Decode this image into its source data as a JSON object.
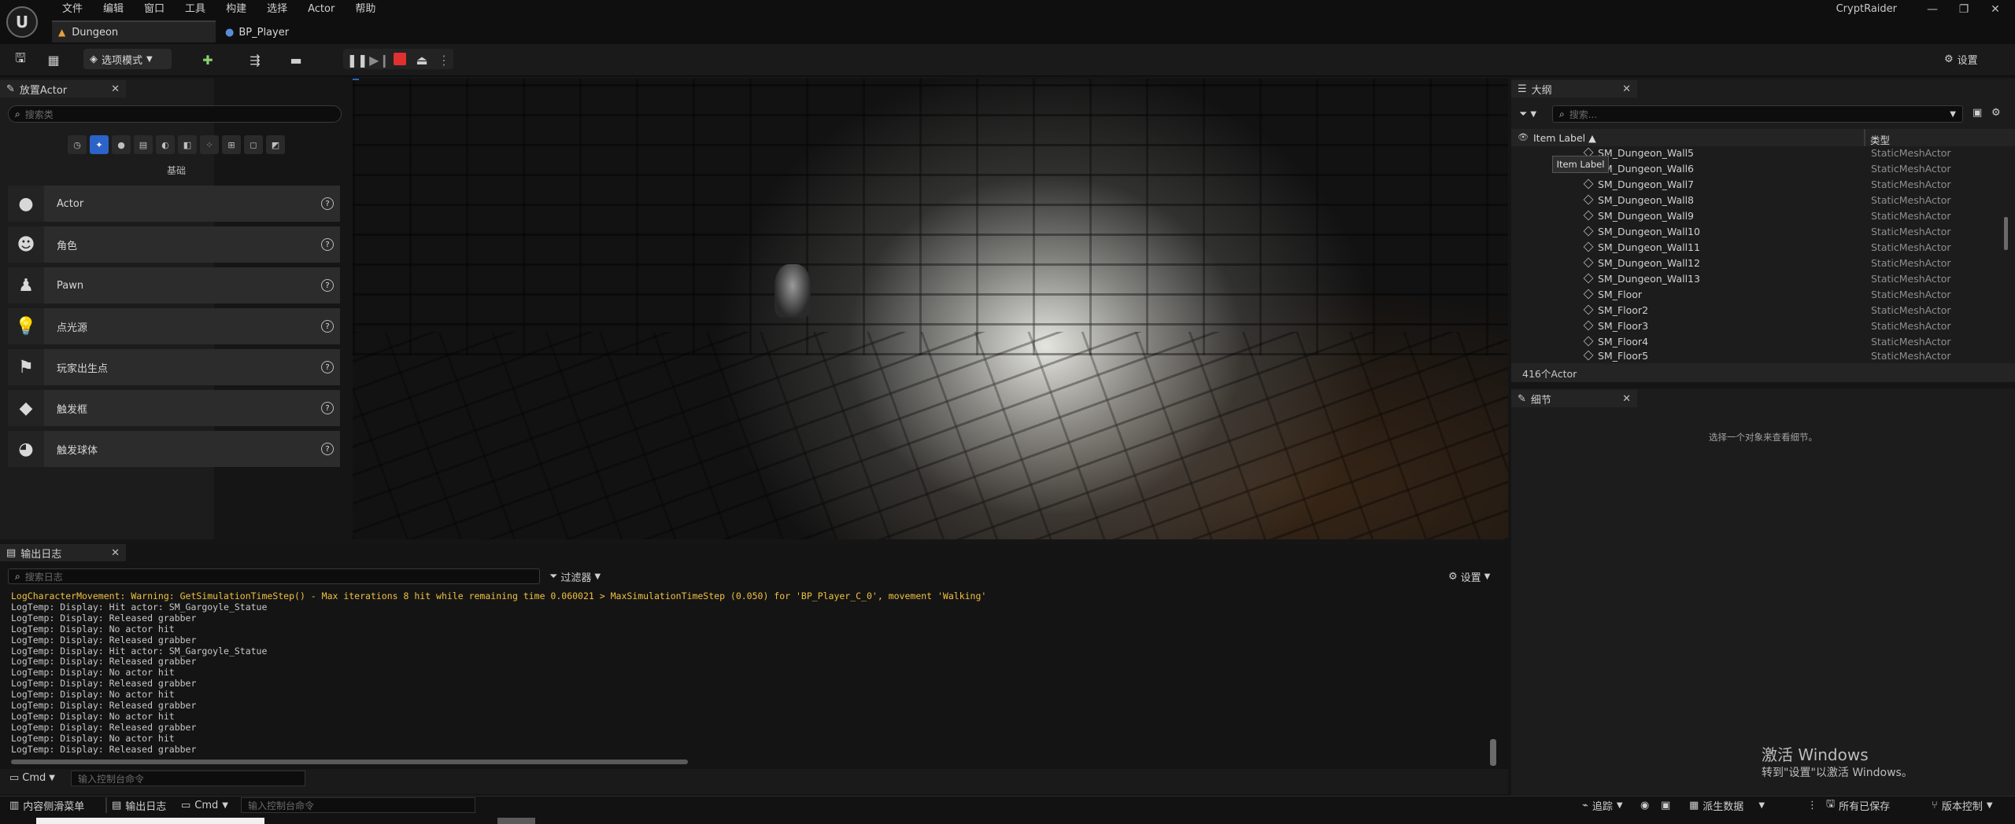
{
  "app": {
    "name": "CryptRaider"
  },
  "menu": [
    "文件",
    "编辑",
    "窗口",
    "工具",
    "构建",
    "选择",
    "Actor",
    "帮助"
  ],
  "tabs": [
    {
      "label": "Dungeon"
    },
    {
      "label": "BP_Player"
    }
  ],
  "toolbar": {
    "mode_label": "选项模式",
    "settings_label": "设置"
  },
  "place_actors": {
    "title": "放置Actor",
    "search_placeholder": "搜索类",
    "category_label": "基础",
    "items": [
      {
        "label": "Actor",
        "icon": "sphere-icon"
      },
      {
        "label": "角色",
        "icon": "character-icon"
      },
      {
        "label": "Pawn",
        "icon": "pawn-icon"
      },
      {
        "label": "点光源",
        "icon": "point-light-icon"
      },
      {
        "label": "玩家出生点",
        "icon": "player-start-icon"
      },
      {
        "label": "触发框",
        "icon": "trigger-box-icon"
      },
      {
        "label": "触发球体",
        "icon": "trigger-sphere-icon"
      }
    ]
  },
  "outliner": {
    "title": "大纲",
    "search_placeholder": "搜索...",
    "col_label": "Item Label",
    "col_type": "类型",
    "tooltip": "Item Label",
    "rows": [
      {
        "name": "SM_Dungeon_Wall5",
        "type": "StaticMeshActor"
      },
      {
        "name": "SM_Dungeon_Wall6",
        "type": "StaticMeshActor"
      },
      {
        "name": "SM_Dungeon_Wall7",
        "type": "StaticMeshActor"
      },
      {
        "name": "SM_Dungeon_Wall8",
        "type": "StaticMeshActor"
      },
      {
        "name": "SM_Dungeon_Wall9",
        "type": "StaticMeshActor"
      },
      {
        "name": "SM_Dungeon_Wall10",
        "type": "StaticMeshActor"
      },
      {
        "name": "SM_Dungeon_Wall11",
        "type": "StaticMeshActor"
      },
      {
        "name": "SM_Dungeon_Wall12",
        "type": "StaticMeshActor"
      },
      {
        "name": "SM_Dungeon_Wall13",
        "type": "StaticMeshActor"
      },
      {
        "name": "SM_Floor",
        "type": "StaticMeshActor"
      },
      {
        "name": "SM_Floor2",
        "type": "StaticMeshActor"
      },
      {
        "name": "SM_Floor3",
        "type": "StaticMeshActor"
      },
      {
        "name": "SM_Floor4",
        "type": "StaticMeshActor"
      },
      {
        "name": "SM_Floor5",
        "type": "StaticMeshActor"
      }
    ],
    "count_label": "416个Actor"
  },
  "details": {
    "title": "细节",
    "empty_text": "选择一个对象来查看细节。"
  },
  "output_log": {
    "title": "输出日志",
    "search_placeholder": "搜索日志",
    "filter_label": "过滤器",
    "settings_label": "设置",
    "warning_line": "LogCharacterMovement: Warning: GetSimulationTimeStep() - Max iterations 8 hit while remaining time 0.060021 > MaxSimulationTimeStep (0.050) for 'BP_Player_C_0', movement 'Walking'",
    "lines": [
      "LogTemp: Display: Hit actor: SM_Gargoyle_Statue",
      "LogTemp: Display: Released grabber",
      "LogTemp: Display: No actor hit",
      "LogTemp: Display: Released grabber",
      "LogTemp: Display: Hit actor: SM_Gargoyle_Statue",
      "LogTemp: Display: Released grabber",
      "LogTemp: Display: No actor hit",
      "LogTemp: Display: Released grabber",
      "LogTemp: Display: No actor hit",
      "LogTemp: Display: Released grabber",
      "LogTemp: Display: No actor hit",
      "LogTemp: Display: Released grabber",
      "LogTemp: Display: No actor hit",
      "LogTemp: Display: Released grabber"
    ],
    "cmd_label": "Cmd",
    "cmd_placeholder": "输入控制台命令"
  },
  "statusbar": {
    "content_drawer": "内容侧滑菜单",
    "output_log": "输出日志",
    "cmd_label": "Cmd",
    "cmd_placeholder": "输入控制台命令",
    "trace": "追踪",
    "derived_data": "派生数据",
    "all_saved": "所有已保存",
    "source_control": "版本控制"
  },
  "watermark": {
    "line1": "激活 Windows",
    "line2": "转到\"设置\"以激活 Windows。"
  },
  "colors": {
    "accent": "#2b63c9",
    "warning": "#f0c040",
    "stop": "#e03030"
  }
}
